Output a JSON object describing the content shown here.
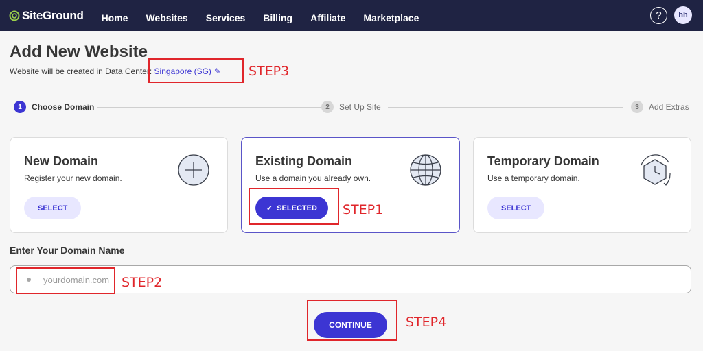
{
  "brand": {
    "name": "SiteGround"
  },
  "nav": {
    "items": [
      "Home",
      "Websites",
      "Services",
      "Billing",
      "Affiliate",
      "Marketplace"
    ]
  },
  "header": {
    "help_label": "?",
    "avatar_initials": "hh"
  },
  "page": {
    "title": "Add New Website",
    "subtitle_prefix": "Website will be created in Data Center: ",
    "data_center": "Singapore (SG)"
  },
  "stepper": {
    "steps": [
      {
        "num": "1",
        "label": "Choose Domain",
        "state": "active"
      },
      {
        "num": "2",
        "label": "Set Up Site",
        "state": "inactive"
      },
      {
        "num": "3",
        "label": "Add Extras",
        "state": "inactive"
      }
    ]
  },
  "cards": [
    {
      "title": "New Domain",
      "desc": "Register your new domain.",
      "button": "SELECT",
      "icon": "plus-circle-icon"
    },
    {
      "title": "Existing Domain",
      "desc": "Use a domain you already own.",
      "button": "SELECTED",
      "icon": "globe-icon"
    },
    {
      "title": "Temporary Domain",
      "desc": "Use a temporary domain.",
      "button": "SELECT",
      "icon": "clock-icon"
    }
  ],
  "domain_field": {
    "label": "Enter Your Domain Name",
    "placeholder": "yourdomain.com",
    "value": ""
  },
  "continue_label": "CONTINUE",
  "annotations": {
    "step1": "STEP1",
    "step2": "STEP2",
    "step3": "STEP3",
    "step4": "STEP4"
  },
  "colors": {
    "topbar": "#1f2343",
    "primary": "#3c35d3",
    "primary_light": "#e8e7ff",
    "annotation": "#e0262b"
  }
}
